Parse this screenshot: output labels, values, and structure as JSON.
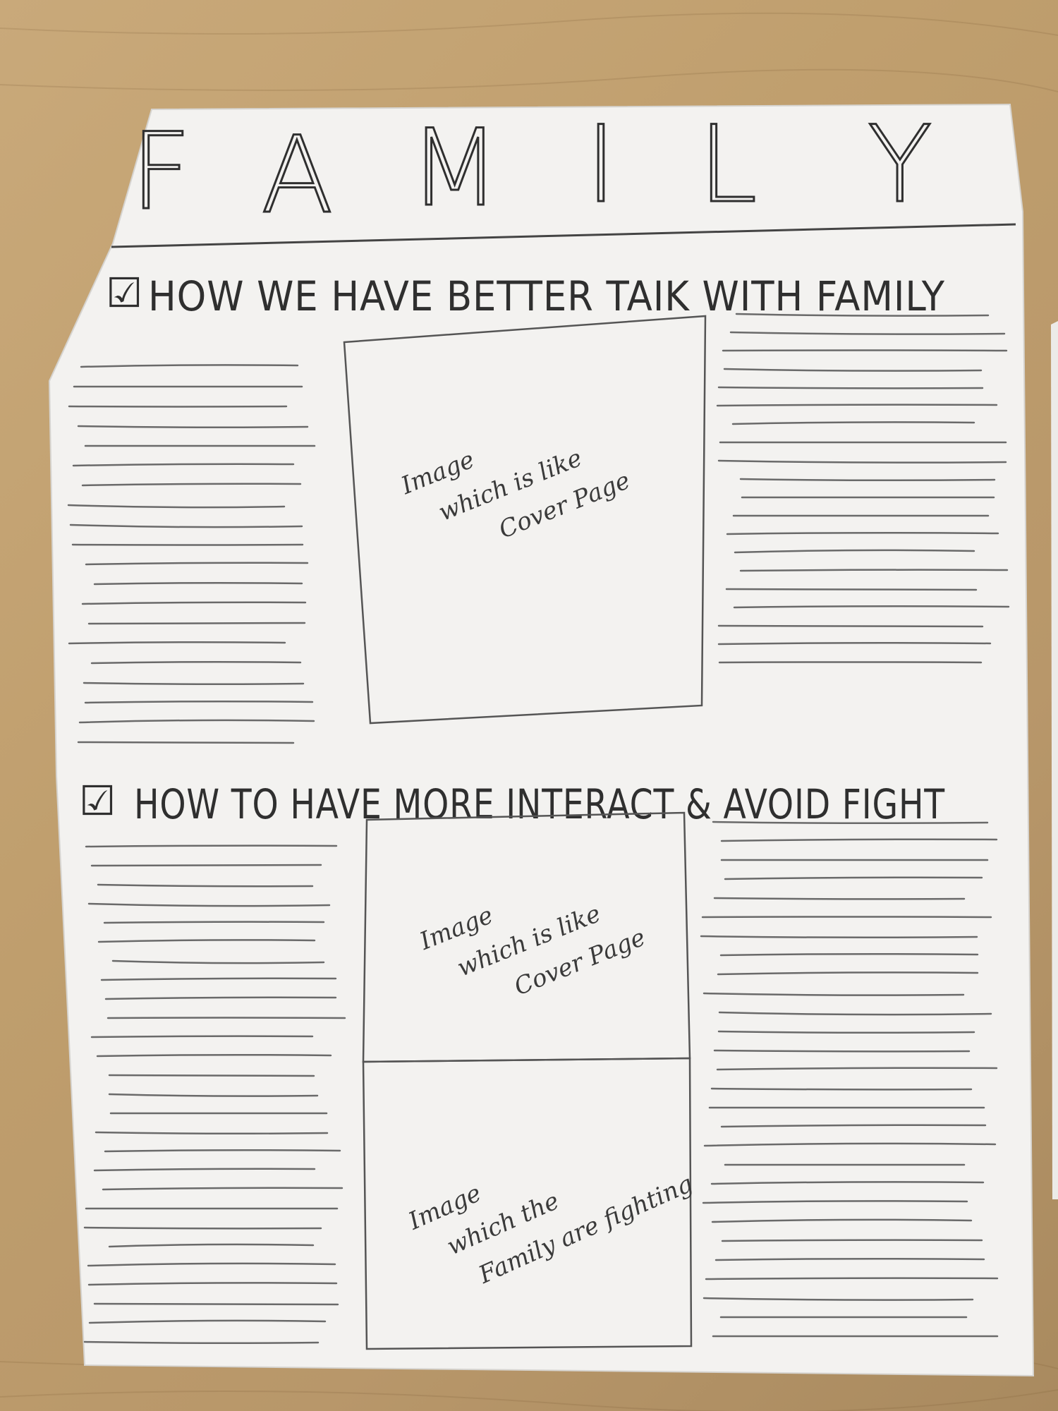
{
  "title_letters": [
    "F",
    "A",
    "M",
    "I",
    "L",
    "Y"
  ],
  "sections": [
    {
      "heading": "HOW WE HAVE BETTER TAIK WITH FAMILY",
      "checkbox": "☑",
      "images": [
        {
          "lines": [
            "Image",
            "which is like",
            "Cover Page"
          ]
        }
      ]
    },
    {
      "heading": "HOW TO HAVE MORE INTERACT & AVOID FIGHT",
      "checkbox": "☑",
      "images": [
        {
          "lines": [
            "Image",
            "which is like",
            "Cover Page"
          ]
        },
        {
          "lines": [
            "Image",
            "which the",
            "Family are fighting"
          ]
        }
      ]
    }
  ],
  "colors": {
    "paper": "#f2f1ef",
    "pencil": "#3a3a3a",
    "table": "#c2a272"
  }
}
